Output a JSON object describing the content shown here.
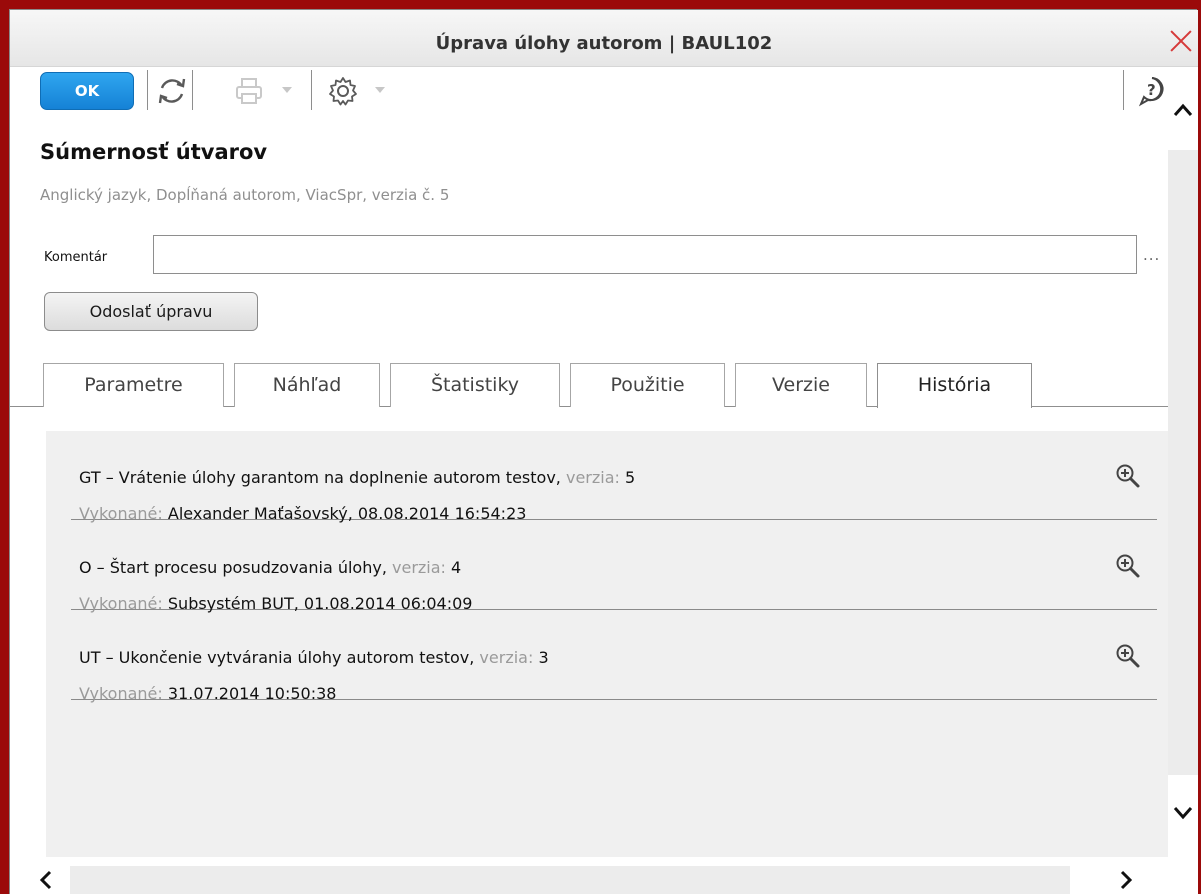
{
  "window": {
    "title": "Úprava úlohy autorom | BAUL102"
  },
  "toolbar": {
    "ok_label": "OK",
    "icons": [
      "refresh-icon",
      "print-icon",
      "settings-icon",
      "help-icon"
    ]
  },
  "item": {
    "title": "Súmernosť útvarov",
    "subtitle": "Anglický jazyk, Dopĺňaná autorom, ViacSpr, verzia č. 5"
  },
  "comment": {
    "label": "Komentár",
    "value": "",
    "more_label": "..."
  },
  "submit_label": "Odoslať úpravu",
  "tabs": [
    {
      "label": "Parametre",
      "active": false
    },
    {
      "label": "Náhľad",
      "active": false
    },
    {
      "label": "Štatistiky",
      "active": false
    },
    {
      "label": "Použitie",
      "active": false
    },
    {
      "label": "Verzie",
      "active": false
    },
    {
      "label": "História",
      "active": true
    }
  ],
  "history": {
    "version_label": "verzia:",
    "performed_label": "Vykonané:",
    "entries": [
      {
        "action": "GT – Vrátenie úlohy garantom na doplnenie autorom testov,",
        "version": "5",
        "performed": "Alexander Maťašovský, 08.08.2014 16:54:23"
      },
      {
        "action": "O – Štart procesu posudzovania úlohy,",
        "version": "4",
        "performed": "Subsystém BUT, 01.08.2014 06:04:09"
      },
      {
        "action": "UT – Ukončenie vytvárania úlohy autorom testov,",
        "version": "3",
        "performed": "31.07.2014 10:50:38"
      }
    ]
  },
  "colors": {
    "frame": "#9b0a0a",
    "ok_button": "#1a8ee0",
    "close": "#d63a3a"
  }
}
